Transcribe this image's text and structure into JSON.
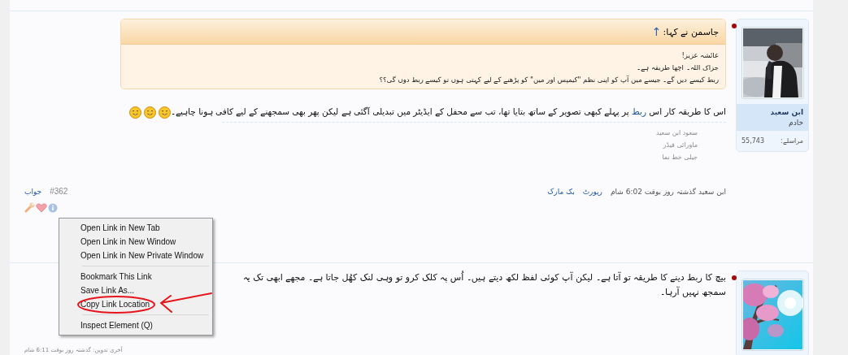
{
  "posts": [
    {
      "online": true,
      "avatar": {
        "kind": "picture"
      },
      "author": {
        "name": "ابن سعید",
        "title": "خادم"
      },
      "stats": [
        {
          "label": "مراسلے:",
          "value": "55,743"
        }
      ],
      "quote": {
        "header": "جاسمن نے کہا:",
        "arrow": "↑",
        "lines": [
          "عائشہ عزیز!",
          "جزاک اللہ۔ اچھا طریقہ ہے۔",
          "ربط کیسے دیں گے۔ جیسے میں آپ کو اپنی نظم \"کیمپس اور میں\" کو پڑھنے کے لیے کہتی ہوں تو کیسے ربط دوں گی؟؟"
        ]
      },
      "body": [
        {
          "kind": "text",
          "text": "اس کا طریقہ کار اس "
        },
        {
          "kind": "link",
          "text": "ربط"
        },
        {
          "kind": "text",
          "text": " پر پہلے کبھی تصویر کے ساتھ بتایا تھا، تب سے محفل کے ایڈیٹر میں تبدیلی آگئی ہے لیکن پھر بھی سمجھنے کے لیے کافی ہونا چاہیے۔"
        }
      ],
      "smileys": [
        {
          "kind": "smile"
        },
        {
          "kind": "smile"
        },
        {
          "kind": "smile"
        }
      ],
      "likes": [
        "سعود ابن سعید",
        "ماورائی فیڈر",
        "جیلی خط نما"
      ],
      "footer": {
        "meta": "ابن سعید گذشتہ روز بوقت 6:02 شام",
        "actions": [
          "رپورٹ",
          "بک مارک"
        ],
        "number": "#362",
        "reply": "جواب"
      },
      "icons": [
        {
          "kind": "wrench"
        },
        {
          "kind": "heart"
        },
        {
          "kind": "info"
        }
      ]
    },
    {
      "online": true,
      "avatar": {
        "kind": "picture"
      },
      "body": [
        {
          "kind": "text",
          "text": "بیچ کا ربط دینے کا طریقہ تو آتا ہے۔ لیکن آپ کوئی لفظ لکھ دیتے ہیں۔ اُس پہ کلک کرو تو وہی لنک کھُل جاتا ہے۔ مجھے ابھی تک یہ سمجھ نہیں آرہا۔"
        }
      ],
      "edit_note": "آخری تدوین: گذشتہ روز بوقت 6:11 شام"
    }
  ],
  "context_menu": {
    "items": [
      {
        "kind": "item",
        "label": "Open Link in New Tab",
        "circled": false
      },
      {
        "kind": "item",
        "label": "Open Link in New Window",
        "circled": false
      },
      {
        "kind": "item",
        "label": "Open Link in New Private Window",
        "circled": false
      },
      {
        "kind": "separator"
      },
      {
        "kind": "item",
        "label": "Bookmark This Link",
        "circled": false
      },
      {
        "kind": "item",
        "label": "Save Link As...",
        "circled": false
      },
      {
        "kind": "item",
        "label": "Copy Link Location",
        "circled": true
      },
      {
        "kind": "separator"
      },
      {
        "kind": "item",
        "label": "Inspect Element (Q)",
        "circled": false
      }
    ]
  }
}
